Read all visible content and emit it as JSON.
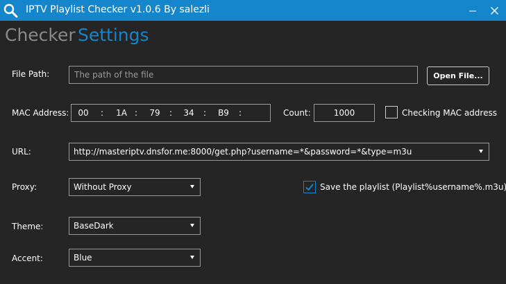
{
  "window": {
    "title": "IPTV Playlist Checker v1.0.6 By salezli",
    "minimize_glyph": "—",
    "close_glyph": "✕"
  },
  "tabs": [
    {
      "label": "Checker",
      "active": false
    },
    {
      "label": "Settings",
      "active": true
    }
  ],
  "file_path": {
    "label": "File Path:",
    "placeholder": "The path of the file",
    "value": "",
    "button_label": "Open File..."
  },
  "mac": {
    "label": "MAC Address:",
    "segments": [
      "00",
      "1A",
      "79",
      "34",
      "B9",
      ""
    ],
    "separator": ":"
  },
  "count": {
    "label": "Count:",
    "value": "1000"
  },
  "checking_mac": {
    "label": "Checking MAC address",
    "checked": false
  },
  "url": {
    "label": "URL:",
    "value": "http://masteriptv.dnsfor.me:8000/get.php?username=*&password=*&type=m3u"
  },
  "proxy": {
    "label": "Proxy:",
    "value": "Without Proxy"
  },
  "save_playlist": {
    "label": "Save the playlist (Playlist%username%.m3u)",
    "checked": true
  },
  "theme": {
    "label": "Theme:",
    "value": "BaseDark"
  },
  "accent": {
    "label": "Accent:",
    "value": "Blue"
  },
  "colors": {
    "accent": "#1585cc",
    "background": "#252525",
    "inactive_tab": "#8a8a8a",
    "border": "#9a9a9a"
  },
  "icons": {
    "app": "search-icon",
    "dropdown": "caret-down-icon",
    "check": "checkmark-icon"
  }
}
